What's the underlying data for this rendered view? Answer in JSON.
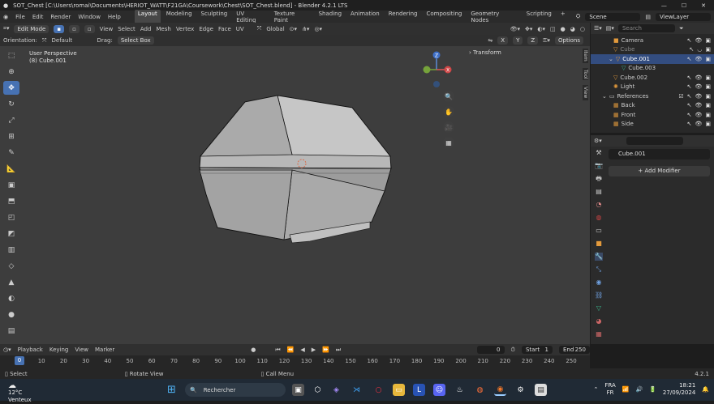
{
  "titlebar": {
    "title": "SOT_Chest [C:\\Users\\romai\\Documents\\HERIOT_WATT\\F21GA\\Coursework\\Chest\\SOT_Chest.blend] - Blender 4.2.1 LTS"
  },
  "menubar": {
    "menus": [
      "File",
      "Edit",
      "Render",
      "Window",
      "Help"
    ],
    "workspaces": [
      "Layout",
      "Modeling",
      "Sculpting",
      "UV Editing",
      "Texture Paint",
      "Shading",
      "Animation",
      "Rendering",
      "Compositing",
      "Geometry Nodes",
      "Scripting"
    ],
    "active_workspace": "Layout",
    "add_tab": "+",
    "scene": "Scene",
    "view_layer": "ViewLayer"
  },
  "viewport_header": {
    "mode": "Edit Mode",
    "menus": [
      "View",
      "Select",
      "Add",
      "Mesh",
      "Vertex",
      "Edge",
      "Face",
      "UV"
    ],
    "transform_orientation": "Global",
    "options": "Options",
    "axes": [
      "X",
      "Y",
      "Z"
    ]
  },
  "viewport_header2": {
    "orientation_label": "Orientation:",
    "orientation_value": "Default",
    "drag_label": "Drag:",
    "drag_value": "Select Box"
  },
  "viewport": {
    "overlay_line1": "User Perspective",
    "overlay_line2": "(8) Cube.001",
    "transform_panel": "Transform",
    "side_tabs": [
      "Item",
      "Tool",
      "View"
    ],
    "gizmo": {
      "x": "X",
      "y": "Y",
      "z": "Z"
    }
  },
  "outliner": {
    "search_placeholder": "Search",
    "rows": [
      {
        "label": "Camera",
        "sel": false
      },
      {
        "label": "Cube",
        "sel": false
      },
      {
        "label": "Cube.001",
        "sel": true
      },
      {
        "label": "Cube.003",
        "sel": false
      },
      {
        "label": "Cube.002",
        "sel": false
      },
      {
        "label": "Light",
        "sel": false
      },
      {
        "label": "References",
        "sel": false
      },
      {
        "label": "Back",
        "sel": false
      },
      {
        "label": "Front",
        "sel": false
      },
      {
        "label": "Side",
        "sel": false
      }
    ]
  },
  "properties": {
    "search_placeholder": "",
    "object_name": "Cube.001",
    "add_modifier": "Add Modifier"
  },
  "timeline": {
    "menus": [
      "Playback",
      "Keying",
      "View",
      "Marker"
    ],
    "current_frame": "0",
    "start_label": "Start",
    "start_value": "1",
    "end_label": "End",
    "end_value": "250",
    "ticks": [
      "0",
      "10",
      "20",
      "30",
      "40",
      "50",
      "60",
      "70",
      "80",
      "90",
      "100",
      "110",
      "120",
      "130",
      "140",
      "150",
      "160",
      "170",
      "180",
      "190",
      "200",
      "210",
      "220",
      "230",
      "240",
      "250"
    ],
    "playhead": "0"
  },
  "statusbar": {
    "select": "Select",
    "rotate": "Rotate View",
    "call_menu": "Call Menu",
    "version": "4.2.1"
  },
  "taskbar": {
    "temp": "12°C",
    "weather": "Venteux",
    "search_placeholder": "Rechercher",
    "lang1": "FRA",
    "lang2": "FR",
    "time": "18:21",
    "date": "27/09/2024"
  },
  "colors": {
    "accent": "#4772b3",
    "selected_row": "#334d80",
    "viewport_bg": "#3d3d3d"
  }
}
